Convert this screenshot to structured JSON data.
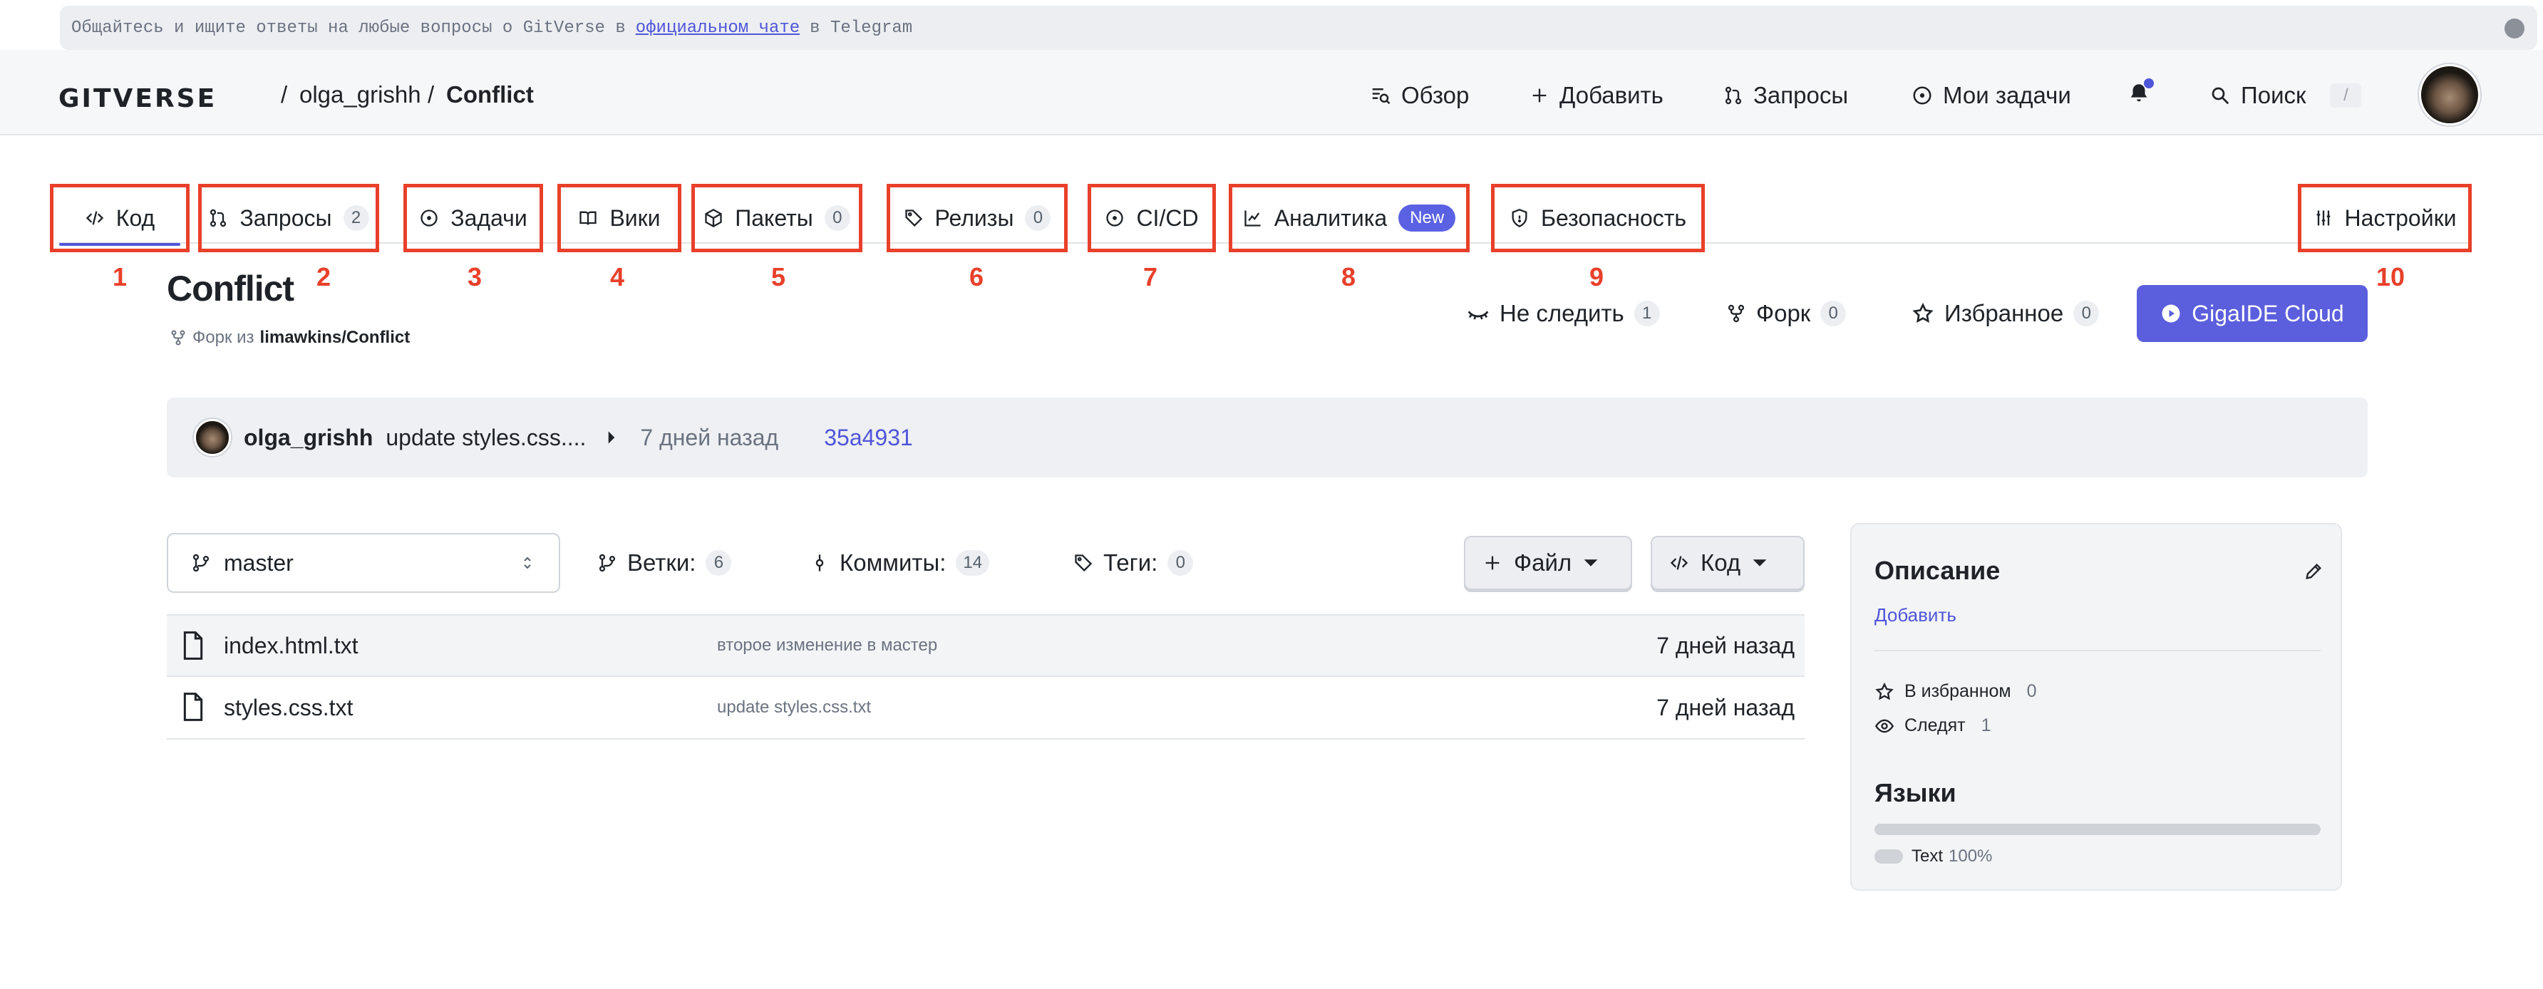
{
  "banner": {
    "text_before": "Общайтесь и ищите ответы на любые вопросы о GitVerse в",
    "link": "официальном чате",
    "text_after": "в Telegram"
  },
  "header": {
    "logo": "GITVERSE",
    "separator": "/",
    "owner": "olga_grishh",
    "repo": "Conflict",
    "nav": {
      "overview": "Обзор",
      "add": "Добавить",
      "requests": "Запросы",
      "my_tasks": "Мои задачи",
      "search": "Поиск",
      "search_shortcut": "/"
    }
  },
  "tabs": [
    {
      "label": "Код",
      "number": "1"
    },
    {
      "label": "Запросы",
      "count": "2",
      "number": "2"
    },
    {
      "label": "Задачи",
      "number": "3"
    },
    {
      "label": "Вики",
      "number": "4"
    },
    {
      "label": "Пакеты",
      "count": "0",
      "number": "5"
    },
    {
      "label": "Релизы",
      "count": "0",
      "number": "6"
    },
    {
      "label": "CI/CD",
      "number": "7"
    },
    {
      "label": "Аналитика",
      "badge": "New",
      "number": "8"
    },
    {
      "label": "Безопасность",
      "number": "9"
    },
    {
      "label": "Настройки",
      "number": "10"
    }
  ],
  "repo": {
    "title": "Conflict",
    "fork_prefix": "Форк из",
    "fork_source": "limawkins/Conflict",
    "actions": {
      "unwatch": "Не следить",
      "unwatch_count": "1",
      "fork": "Форк",
      "fork_count": "0",
      "star": "Избранное",
      "star_count": "0",
      "giga": "GigaIDE Cloud"
    }
  },
  "commit": {
    "author": "olga_grishh",
    "message": "update styles.css....",
    "time": "7 дней назад",
    "sha": "35a4931"
  },
  "toolbar": {
    "branch": "master",
    "branches_label": "Ветки:",
    "branches_count": "6",
    "commits_label": "Коммиты:",
    "commits_count": "14",
    "tags_label": "Теги:",
    "tags_count": "0",
    "file_btn": "Файл",
    "code_btn": "Код"
  },
  "files": [
    {
      "name": "index.html.txt",
      "message": "второе изменение в мастер",
      "time": "7 дней назад"
    },
    {
      "name": "styles.css.txt",
      "message": "update styles.css.txt",
      "time": "7 дней назад"
    }
  ],
  "sidebar": {
    "description_title": "Описание",
    "add": "Добавить",
    "starred_label": "В избранном",
    "starred_count": "0",
    "watching_label": "Следят",
    "watching_count": "1",
    "languages_title": "Языки",
    "lang_name": "Text",
    "lang_pct": "100%"
  },
  "colors": {
    "accent": "#5b5fdd",
    "annotation": "#e8402a"
  }
}
